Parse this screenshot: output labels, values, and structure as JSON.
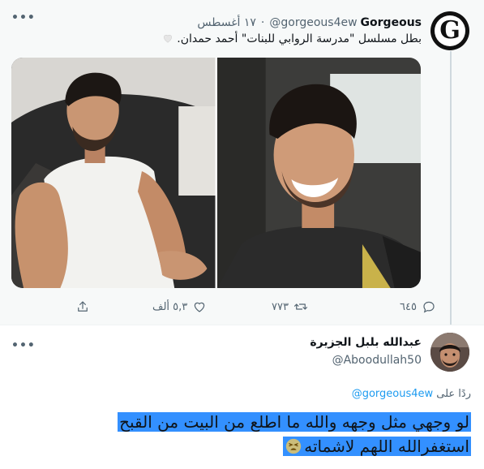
{
  "quoted_tweet": {
    "display_name": "Gorgeous",
    "handle": "@gorgeous4ew",
    "date": "١٧ أغسطس",
    "separator": "·",
    "text": "بطل مسلسل \"مدرسة الروابي للبنات\" أحمد حمدان.",
    "avatar_letter": "G",
    "more_icon": "ellipsis-icon",
    "stats": {
      "replies": "٦٤٥",
      "retweets": "٧٧٣",
      "likes": "٥,٣ ألف"
    }
  },
  "reply_tweet": {
    "display_name": "عبدالله بلبل الجزيرة",
    "handle": "@Aboodullah50",
    "replying_to_label": "ردًا على",
    "replying_to_handle": "@gorgeous4ew",
    "text": "لو وجهي مثل وجهه والله ما اطلع من البيت من القبح استغفرالله اللهم لاشماته",
    "selection_color": "#3390ff"
  },
  "colors": {
    "link": "#1d9bf0",
    "secondary_text": "#536471",
    "thread_line": "#cfd9de",
    "quoted_background": "#f7f9f9"
  }
}
